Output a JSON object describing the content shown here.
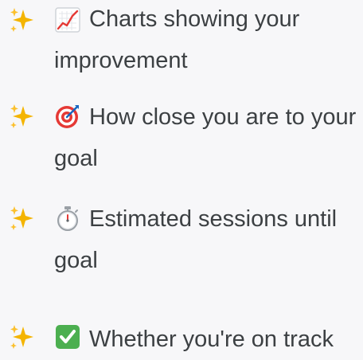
{
  "items": [
    {
      "icon": "chart-increasing-icon",
      "text": "Charts showing your improvement"
    },
    {
      "icon": "target-icon",
      "text": "How close you are to your goal"
    },
    {
      "icon": "stopwatch-icon",
      "text": "Estimated sessions until goal"
    },
    {
      "icon": "check-mark-button-icon",
      "text": "Whether you're on track"
    }
  ],
  "bullet_icon": "sparkles-icon",
  "colors": {
    "background": "#f7f7f9",
    "text": "#3c4043",
    "sparkle": "#f4b400",
    "target_red": "#e53935",
    "check_green": "#4caf50"
  }
}
